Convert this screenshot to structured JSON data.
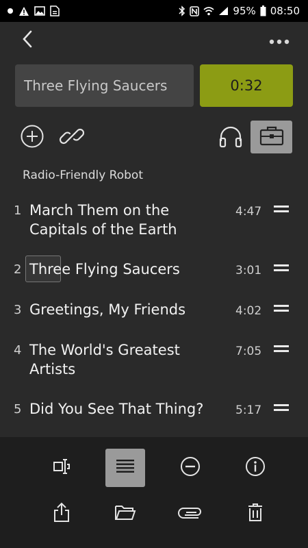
{
  "status_bar": {
    "battery": "95%",
    "time": "08:50",
    "icons": [
      "notification-dot-icon",
      "warning-icon",
      "image-icon",
      "file-icon",
      "bluetooth-icon",
      "nfc-icon",
      "wifi-icon",
      "signal-icon",
      "battery-icon"
    ]
  },
  "header": {
    "track_title": "Three Flying Saucers",
    "elapsed_time": "0:32",
    "accent_color": "#8c9c14"
  },
  "toolbar_icons": [
    "add-circle-icon",
    "link-icon",
    "headphones-icon",
    "briefcase-icon"
  ],
  "album": {
    "name": "Radio-Friendly Robot"
  },
  "tracks": [
    {
      "number": "1",
      "title": "March Them on the Capitals of the Earth",
      "duration": "4:47"
    },
    {
      "number": "2",
      "title": "Three Flying Saucers",
      "duration": "3:01"
    },
    {
      "number": "3",
      "title": "Greetings, My Friends",
      "duration": "4:02"
    },
    {
      "number": "4",
      "title": "The World's Greatest Artists",
      "duration": "7:05"
    },
    {
      "number": "5",
      "title": "Did You See That Thing?",
      "duration": "5:17"
    }
  ],
  "bottom_bar": {
    "row1": [
      "text-cursor-icon",
      "list-view-icon",
      "remove-circle-icon",
      "info-icon"
    ],
    "row2": [
      "share-icon",
      "folder-open-icon",
      "attachment-icon",
      "trash-icon"
    ],
    "active": "list-view-icon"
  }
}
